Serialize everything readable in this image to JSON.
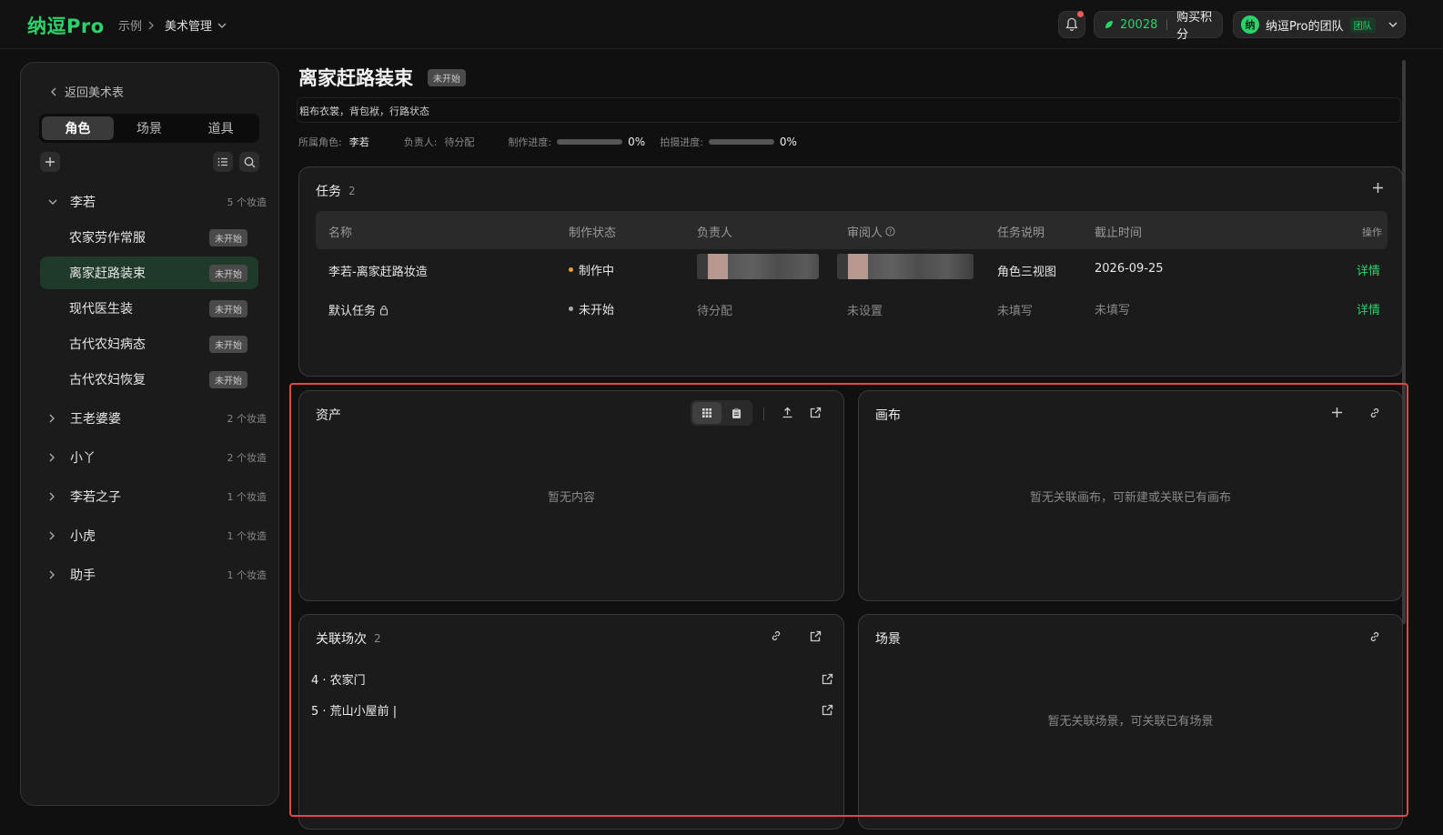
{
  "topbar": {
    "logo": "纳逗Pro",
    "breadcrumb": [
      "示例",
      "美术管理"
    ],
    "points": "20028",
    "buy_points": "购买积分",
    "team_avatar": "纳",
    "team_name": "纳逗Pro的团队",
    "team_badge": "团队"
  },
  "sidebar": {
    "back": "返回美术表",
    "tabs": [
      "角色",
      "场景",
      "道具"
    ],
    "groups": [
      {
        "name": "李若",
        "count": "5 个妆造",
        "expanded": true,
        "items": [
          {
            "name": "农家劳作常服",
            "status": "未开始"
          },
          {
            "name": "离家赶路装束",
            "status": "未开始",
            "selected": true
          },
          {
            "name": "现代医生装",
            "status": "未开始"
          },
          {
            "name": "古代农妇病态",
            "status": "未开始"
          },
          {
            "name": "古代农妇恢复",
            "status": "未开始"
          }
        ]
      },
      {
        "name": "王老婆婆",
        "count": "2 个妆造"
      },
      {
        "name": "小丫",
        "count": "2 个妆造"
      },
      {
        "name": "李若之子",
        "count": "1 个妆造"
      },
      {
        "name": "小虎",
        "count": "1 个妆造"
      },
      {
        "name": "助手",
        "count": "1 个妆造"
      }
    ]
  },
  "detail": {
    "title": "离家赶路装束",
    "status": "未开始",
    "description": "粗布衣裳，背包袱，行路状态",
    "role_label": "所属角色:",
    "role_value": "李若",
    "owner_label": "负责人:",
    "owner_value": "待分配",
    "production_label": "制作进度:",
    "production_value": "0%",
    "production_progress": 0,
    "shoot_label": "拍摄进度:",
    "shoot_value": "0%",
    "shoot_progress": 0
  },
  "tasks": {
    "title": "任务",
    "count": "2",
    "columns": [
      "名称",
      "制作状态",
      "负责人",
      "审阅人",
      "任务说明",
      "截止时间",
      "操作"
    ],
    "rows": [
      {
        "name": "李若-离家赶路妆造",
        "status": "制作中",
        "status_color": "#f0a030",
        "owner": "",
        "reviewer": "",
        "note": "角色三视图",
        "deadline": "2026-09-25",
        "action": "详情"
      },
      {
        "name": "默认任务",
        "status": "未开始",
        "status_color": "#aaaaaa",
        "owner": "待分配",
        "reviewer": "未设置",
        "note": "未填写",
        "deadline": "未填写",
        "action": "详情"
      }
    ]
  },
  "assets": {
    "title": "资产",
    "empty": "暂无内容"
  },
  "canvas": {
    "title": "画布",
    "empty": "暂无关联画布，可新建或关联已有画布"
  },
  "scenes_linked": {
    "title": "关联场次",
    "count": "2",
    "items": [
      "4 · 农家门",
      "5 · 荒山小屋前 |"
    ]
  },
  "scene": {
    "title": "场景",
    "empty": "暂无关联场景，可关联已有场景"
  },
  "colors": {
    "accent": "#2bd36a",
    "highlight": "#e04848"
  }
}
